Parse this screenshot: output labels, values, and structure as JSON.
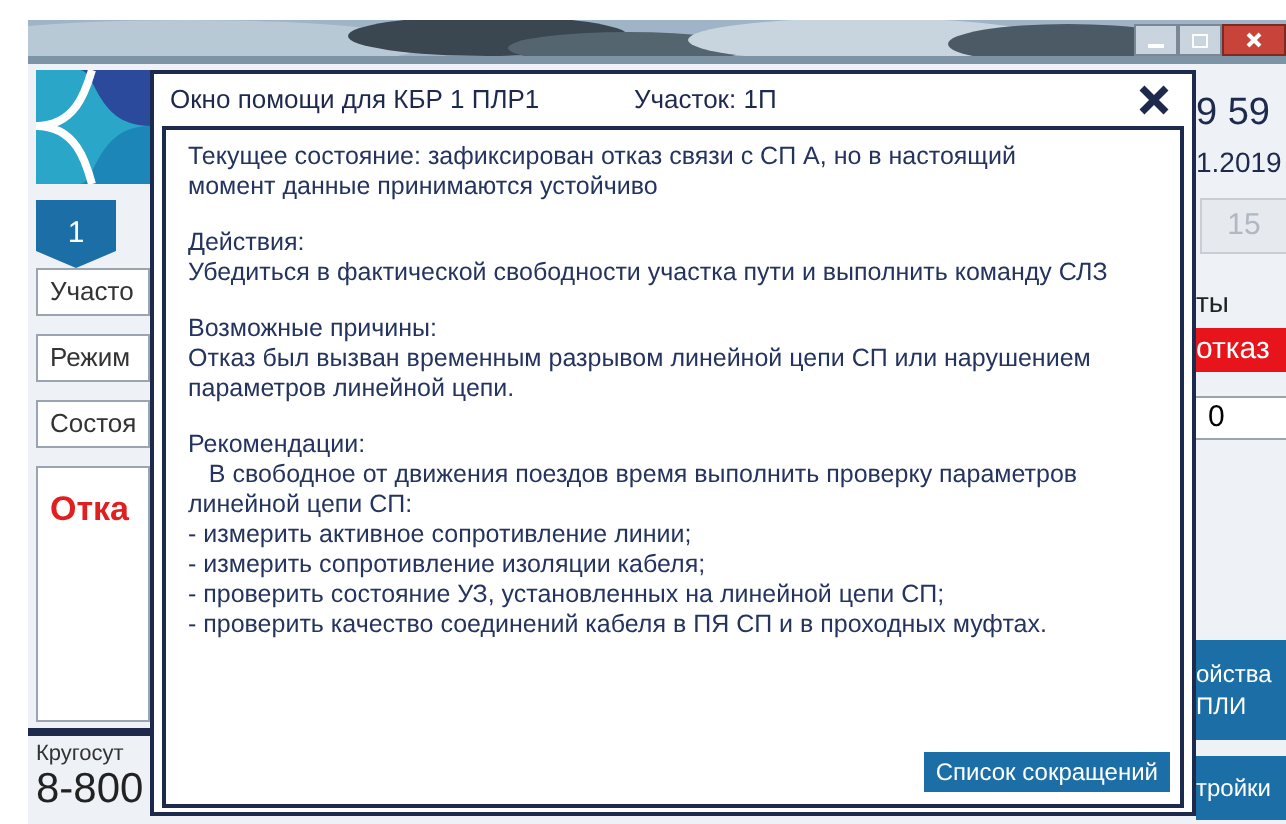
{
  "app": {
    "clock": "9 59",
    "date": "1.2019",
    "tabs": [
      {
        "label": "1",
        "selected": true
      },
      {
        "label": "15",
        "selected": false
      }
    ],
    "fields": [
      "Участо",
      "Режим",
      "Состоя"
    ],
    "alert": "Отка",
    "hotline": {
      "label": "Кругосут",
      "phone": "8-800"
    },
    "right_label": "ты",
    "status": "отказ",
    "counter": "0",
    "buttons": [
      [
        "ойства",
        "ПЛИ"
      ],
      [
        "тройки"
      ]
    ]
  },
  "dialog": {
    "title": "Окно помощи для КБР 1 ПЛР1",
    "section": "Участок: 1П",
    "blocks": [
      [
        "Текущее состояние: зафиксирован отказ связи с СП А, но в настоящий",
        "момент данные принимаются устойчиво"
      ],
      [
        "Действия:",
        "Убедиться в фактической свободности участка пути и выполнить команду СЛЗ"
      ],
      [
        "Возможные причины:",
        "Отказ был вызван временным разрывом линейной цепи СП или нарушением",
        "параметров линейной цепи."
      ],
      [
        "Рекомендации:",
        "   В свободное от движения поездов время выполнить проверку параметров",
        "линейной цепи СП:",
        "- измерить активное сопротивление линии;",
        "- измерить сопротивление изоляции кабеля;",
        "- проверить состояние УЗ, установленных на линейной цепи СП;",
        "- проверить качество соединений кабеля в ПЯ СП и в проходных муфтах."
      ]
    ],
    "button": "Список сокращений"
  }
}
